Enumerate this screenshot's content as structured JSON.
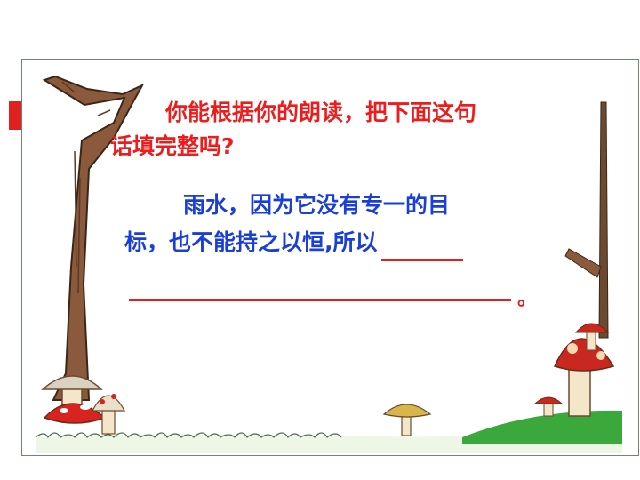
{
  "question": {
    "line1": "你能根据你的朗读，把下面这句",
    "line2": "话填完整吗?"
  },
  "answer": {
    "line1": "雨水，因为它没有专一的目",
    "line2": "标，也不能持之以恒,所以"
  },
  "period": "。",
  "colors": {
    "question": "#ee1c1c",
    "answer": "#1a3fd6",
    "blank_line": "#e32020",
    "frame_border": "#6b8a6b"
  }
}
